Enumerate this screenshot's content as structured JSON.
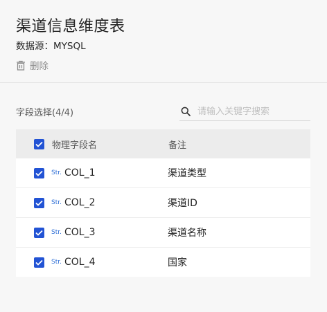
{
  "header": {
    "title": "渠道信息维度表",
    "source": "数据源：MYSQL",
    "delete_label": "删除"
  },
  "fields": {
    "count_label": "字段选择(4/4)",
    "search_placeholder": "请输入关键字搜索",
    "columns": {
      "name": "物理字段名",
      "remark": "备注"
    },
    "rows": [
      {
        "type": "Str.",
        "name": "COL_1",
        "remark": "渠道类型",
        "checked": true
      },
      {
        "type": "Str.",
        "name": "COL_2",
        "remark": "渠道ID",
        "checked": true
      },
      {
        "type": "Str.",
        "name": "COL_3",
        "remark": "渠道名称",
        "checked": true
      },
      {
        "type": "Str.",
        "name": "COL_4",
        "remark": "国家",
        "checked": true
      }
    ]
  },
  "colors": {
    "accent": "#2253d4",
    "type_tag": "#2f6fd6"
  },
  "icons": {
    "delete": "trash-icon",
    "search": "search-icon",
    "check": "check-icon"
  }
}
